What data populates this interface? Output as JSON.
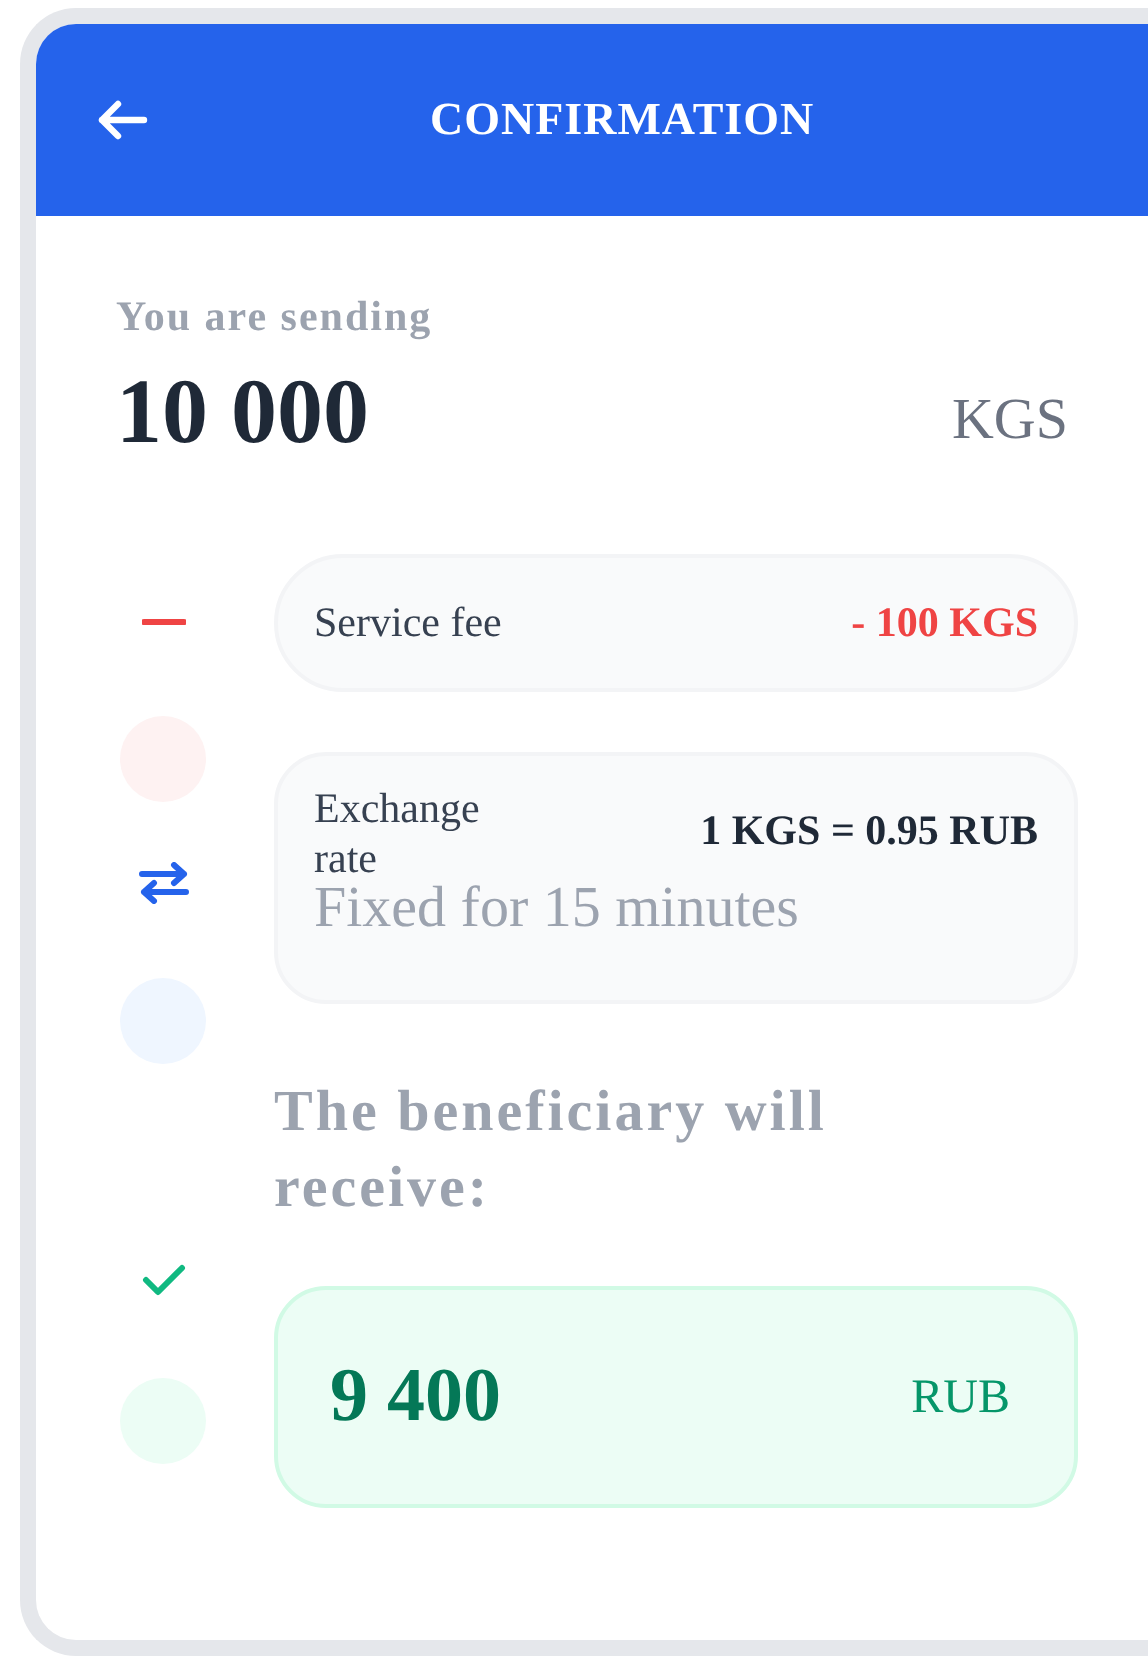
{
  "header": {
    "title": "CONFIRMATION"
  },
  "sending": {
    "label": "You are sending",
    "amount": "10 000",
    "currency": "KGS"
  },
  "steps": [
    {
      "kind": "fee",
      "label": "Service fee",
      "value": "- 100 KGS"
    },
    {
      "kind": "rate",
      "label": "Exchange rate",
      "value": "1 KGS = 0.95 RUB",
      "note": "Fixed for 15 minutes"
    }
  ],
  "receive": {
    "label": "The beneficiary will receive:",
    "amount": "9 400",
    "currency": "RUB"
  }
}
